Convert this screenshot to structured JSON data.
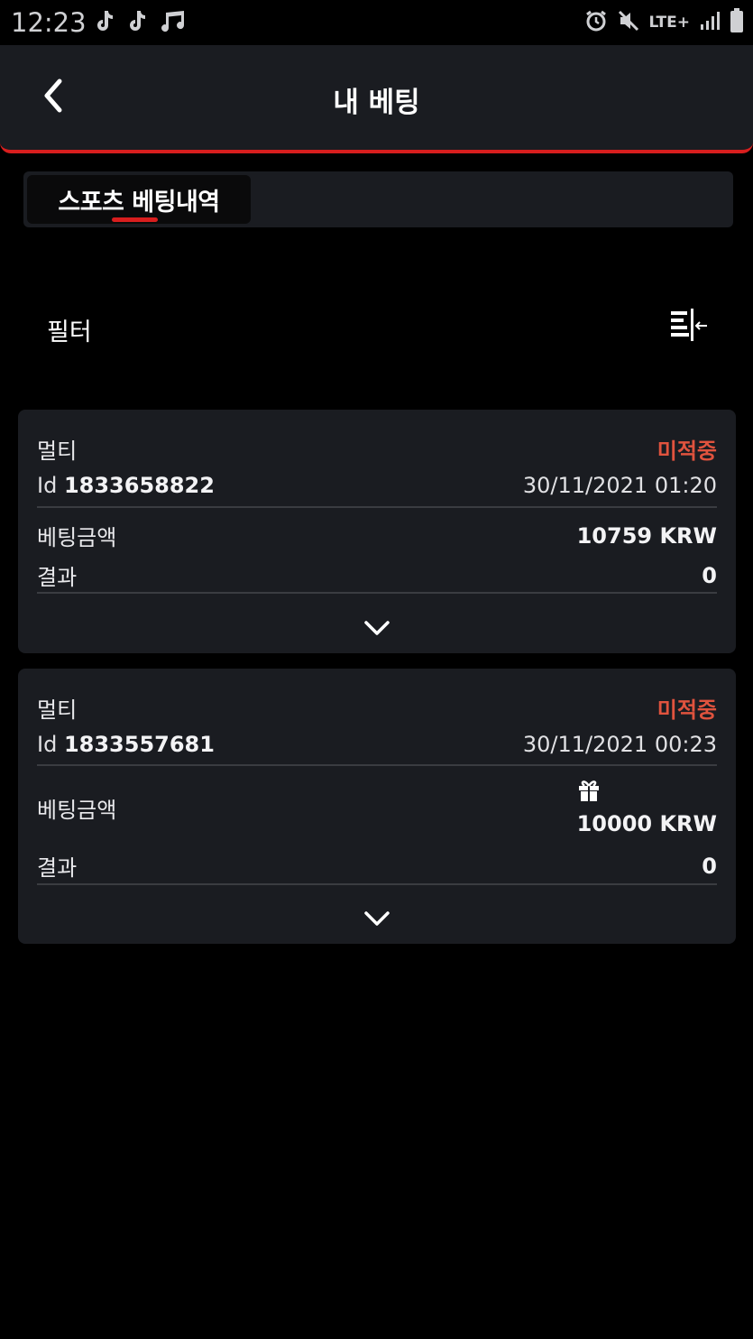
{
  "status_bar": {
    "time": "12:23",
    "left_icons": [
      "tiktok-icon",
      "tiktok-icon",
      "music-icon"
    ],
    "right_icons": [
      "alarm-icon",
      "mute-icon",
      "lte-icon",
      "signal-icon",
      "battery-icon"
    ],
    "network": "LTE+"
  },
  "header": {
    "title": "내 베팅",
    "back_icon": "chevron-left-icon"
  },
  "tabs": [
    {
      "label": "스포츠 베팅내역",
      "active": true
    }
  ],
  "filter": {
    "label": "필터",
    "icon": "filter-sort-icon"
  },
  "bets": [
    {
      "type": "멀티",
      "status": "미적중",
      "id_label": "Id",
      "id_value": "1833658822",
      "datetime": "30/11/2021 01:20",
      "amount_label": "베팅금액",
      "amount": "10759 KRW",
      "result_label": "결과",
      "result": "0",
      "has_gift": false
    },
    {
      "type": "멀티",
      "status": "미적중",
      "id_label": "Id",
      "id_value": "1833557681",
      "datetime": "30/11/2021 00:23",
      "amount_label": "베팅금액",
      "amount": "10000 KRW",
      "result_label": "결과",
      "result": "0",
      "has_gift": true
    }
  ],
  "colors": {
    "accent_red": "#d81e1e",
    "status_red": "#e0533e",
    "card_bg": "#1a1c21",
    "page_bg": "#000000"
  }
}
